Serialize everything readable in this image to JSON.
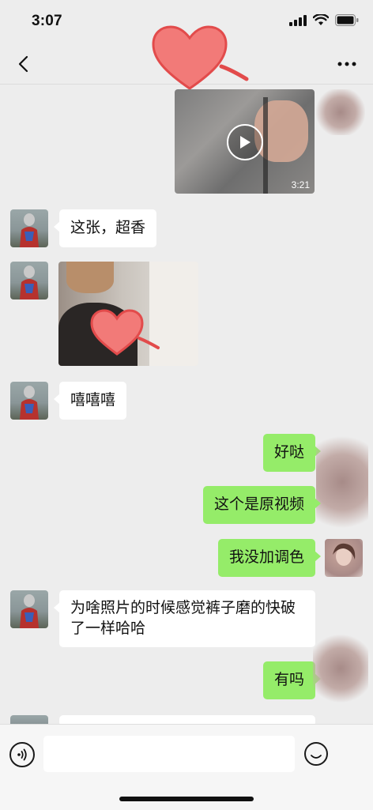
{
  "status_bar": {
    "time": "3:07"
  },
  "video_message": {
    "duration": "3:21"
  },
  "messages": [
    {
      "text": "这张，超香"
    },
    {
      "text": "嘻嘻嘻"
    },
    {
      "text": "好哒"
    },
    {
      "text": "这个是原视频"
    },
    {
      "text": "我没加调色"
    },
    {
      "text": "为啥照片的时候感觉裤子磨的快破了一样哈哈"
    },
    {
      "text": "有吗"
    }
  ],
  "colors": {
    "background": "#ededed",
    "outgoing_bubble": "#95ec69",
    "incoming_bubble": "#ffffff",
    "heart": "#f26d6d"
  },
  "icons": [
    "back-icon",
    "more-icon",
    "signal-icon",
    "wifi-icon",
    "battery-icon",
    "play-icon",
    "voice-icon",
    "emoji-icon",
    "heart-icon"
  ]
}
